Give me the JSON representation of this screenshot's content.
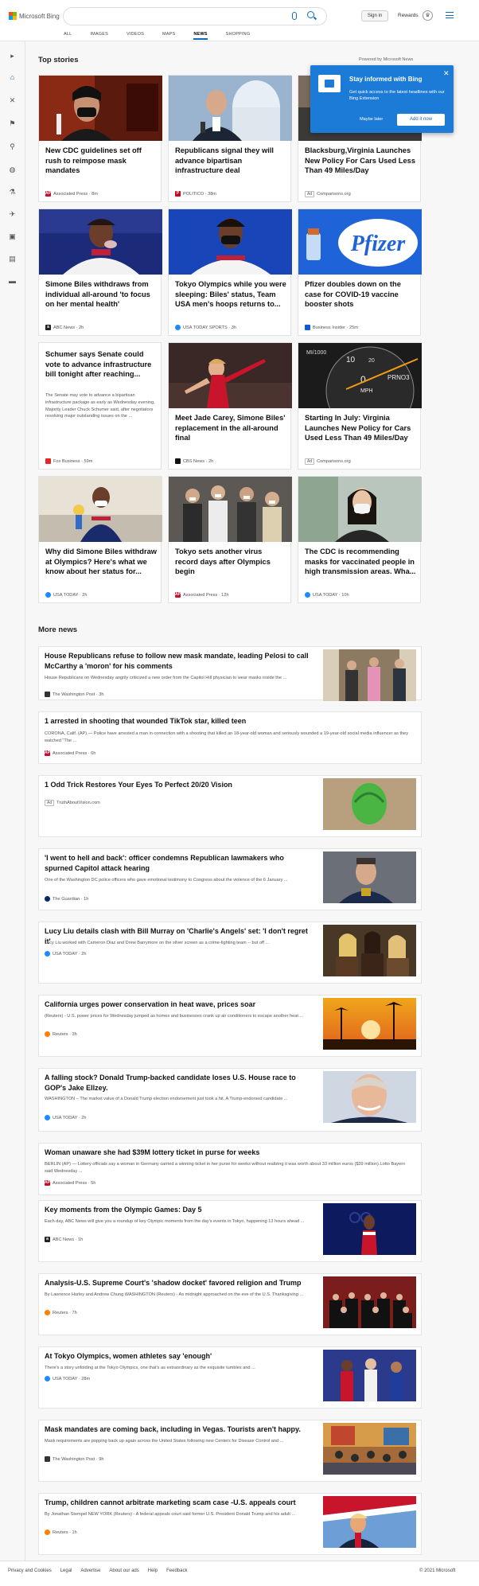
{
  "header": {
    "logo_text": "Microsoft Bing",
    "signin_label": "Sign in",
    "rewards_label": "Rewards",
    "nav": [
      "ALL",
      "IMAGES",
      "VIDEOS",
      "MAPS",
      "NEWS",
      "SHOPPING"
    ],
    "active_nav": "NEWS"
  },
  "top_stories": {
    "heading": "Top stories",
    "powered_by": "Powered by Microsoft News",
    "cards": [
      {
        "title": "New CDC guidelines set off rush to reimpose mask mandates",
        "source": "Associated Press · 8m",
        "logo": "AP",
        "logo_color": "#c8102e"
      },
      {
        "title": "Republicans signal they will advance bipartisan infrastructure deal",
        "source": "POLITICO · 38m",
        "logo": "P",
        "logo_color": "#d0021b"
      },
      {
        "title": "Blacksburg,Virginia Launches New Policy For Cars Used Less Than 49 Miles/Day",
        "source": "Comparisons.org",
        "ad": "Ad"
      },
      {
        "title": "Simone Biles withdraws from individual all-around 'to focus on her mental health'",
        "source": "ABC News · 2h",
        "logo": "a",
        "logo_color": "#222"
      },
      {
        "title": "Tokyo Olympics while you were sleeping: Biles' status, Team USA men's hoops returns to...",
        "source": "USA TODAY SPORTS · 3h",
        "logo": "",
        "logo_color": "#1a8cff"
      },
      {
        "title": "Pfizer doubles down on the case for COVID-19 vaccine booster shots",
        "source": "Business Insider · 25m",
        "logo": "",
        "logo_color": "#0b5cd6"
      },
      {
        "title": "Schumer says Senate could vote to advance infrastructure bill tonight after reaching...",
        "snippet": "The Senate may vote to advance a bipartisan infrastructure package as early as Wednesday evening, Majority Leader Chuck Schumer said, after negotiators resolving major outstanding issues on the ...",
        "source": "Fox Business · 59m",
        "logo": "",
        "logo_color": "#e3262a"
      },
      {
        "title": "Meet Jade Carey, Simone Biles' replacement in the all-around final",
        "source": "CBS News · 2h",
        "logo": "",
        "logo_color": "#111"
      },
      {
        "title": "Starting In July: Virginia Launches New Policy for Cars Used Less Than 49 Miles/Day",
        "source": "Comparisons.org",
        "ad": "Ad"
      },
      {
        "title": "Why did Simone Biles withdraw at Olympics? Here's what we know about her status for...",
        "source": "USA TODAY · 2h",
        "logo": "",
        "logo_color": "#1a8cff"
      },
      {
        "title": "Tokyo sets another virus record days after Olympics begin",
        "source": "Associated Press · 12h",
        "logo": "AP",
        "logo_color": "#c8102e"
      },
      {
        "title": "The CDC is recommending masks for vaccinated people in high transmission areas. Wha...",
        "source": "USA TODAY · 10h",
        "logo": "",
        "logo_color": "#1a8cff"
      }
    ]
  },
  "popup": {
    "title": "Stay informed with Bing",
    "body": "Get quick access to the latest headlines with our Bing Extension",
    "later": "Maybe later",
    "add": "Add it now",
    "close": "✕"
  },
  "more_news": {
    "heading": "More news",
    "items": [
      {
        "title": "House Republicans refuse to follow new mask mandate, leading Pelosi to call McCarthy a 'moron' for his comments",
        "snippet": "House Republicans on Wednesday angrily criticized a new order from the Capitol Hill physician to wear masks inside the ...",
        "source": "The Washington Post · 3h",
        "logo": "wp",
        "logo_color": "#333"
      },
      {
        "title": "1 arrested in shooting that wounded TikTok star, killed teen",
        "snippet": "CORONA, Calif. (AP) — Police have arrested a man in connection with a shooting that killed an 18-year-old woman and seriously wounded a 19-year-old social media influencer as they watched \"The ...",
        "source": "Associated Press · 6h",
        "logo": "AP",
        "logo_color": "#c8102e"
      },
      {
        "title": "1 Odd Trick Restores Your Eyes To Perfect 20/20 Vision",
        "snippet": "",
        "source": "TruthAboutVision.com",
        "ad": "Ad"
      },
      {
        "title": "'I went to hell and back': officer condemns Republican lawmakers who spurned Capitol attack hearing",
        "snippet": "One of the Washington DC police officers who gave emotional testimony to Congress about the violence of the 6 January ...",
        "source": "The Guardian · 1h",
        "logo": "",
        "logo_color": "#052962"
      },
      {
        "title": "Lucy Liu details clash with Bill Murray on 'Charlie's Angels' set: 'I don't regret it'",
        "snippet": "Lucy Liu worked with Cameron Diaz and Drew Barrymore on the silver screen as a crime-fighting team -- but off ...",
        "source": "USA TODAY · 2h",
        "logo": "",
        "logo_color": "#1a8cff"
      },
      {
        "title": "California urges power conservation in heat wave, prices soar",
        "snippet": "(Reuters) - U.S. power prices for Wednesday jumped as homes and businesses crank up air conditioners to escape another heat ...",
        "source": "Reuters · 3h",
        "logo": "",
        "logo_color": "#ff8000"
      },
      {
        "title": "A falling stock? Donald Trump-backed candidate loses U.S. House race to GOP's Jake Ellzey.",
        "snippet": "WASHINGTON – The market value of a Donald Trump election endorsement just took a hit. A Trump-endorsed candidate ...",
        "source": "USA TODAY · 2h",
        "logo": "",
        "logo_color": "#1a8cff"
      },
      {
        "title": "Woman unaware she had $39M lottery ticket in purse for weeks",
        "snippet": "BERLIN (AP) — Lottery officials say a woman in Germany carried a winning ticket in her purse for weeks without realizing it was worth about 33 million euros ($39 million).Lotto Bayern said Wednesday ...",
        "source": "Associated Press · 5h",
        "logo": "AP",
        "logo_color": "#c8102e"
      },
      {
        "title": "Key moments from the Olympic Games: Day 5",
        "snippet": "Each day, ABC News will give you a roundup of key Olympic moments from the day's events in Tokyo, happening 13 hours ahead ...",
        "source": "ABC News · 1h",
        "logo": "a",
        "logo_color": "#222"
      },
      {
        "title": "Analysis-U.S. Supreme Court's 'shadow docket' favored religion and Trump",
        "snippet": "By Lawrence Hurley and Andrew Chung WASHINGTON (Reuters) - As midnight approached on the eve of the U.S. Thanksgiving ...",
        "source": "Reuters · 7h",
        "logo": "",
        "logo_color": "#ff8000"
      },
      {
        "title": "At Tokyo Olympics, women athletes say 'enough'",
        "snippet": "There's a story unfolding at the Tokyo Olympics, one that's as extraordinary as the exquisite tumbles and ...",
        "source": "USA TODAY · 28m",
        "logo": "",
        "logo_color": "#1a8cff"
      },
      {
        "title": "Mask mandates are coming back, including in Vegas. Tourists aren't happy.",
        "snippet": "Mask requirements are popping back up again across the United States following new Centers for Disease Control and ...",
        "source": "The Washington Post · 9h",
        "logo": "wp",
        "logo_color": "#333"
      },
      {
        "title": "Trump, children cannot arbitrate marketing scam case -U.S. appeals court",
        "snippet": "By Jonathan Stempel NEW YORK (Reuters) - A federal appeals court said former U.S. President Donald Trump and his adult ...",
        "source": "Reuters · 1h",
        "logo": "",
        "logo_color": "#ff8000"
      }
    ]
  },
  "footer": {
    "links": [
      "Privacy and Cookies",
      "Legal",
      "Advertise",
      "About our ads",
      "Help",
      "Feedback"
    ],
    "copyright": "© 2021 Microsoft"
  }
}
